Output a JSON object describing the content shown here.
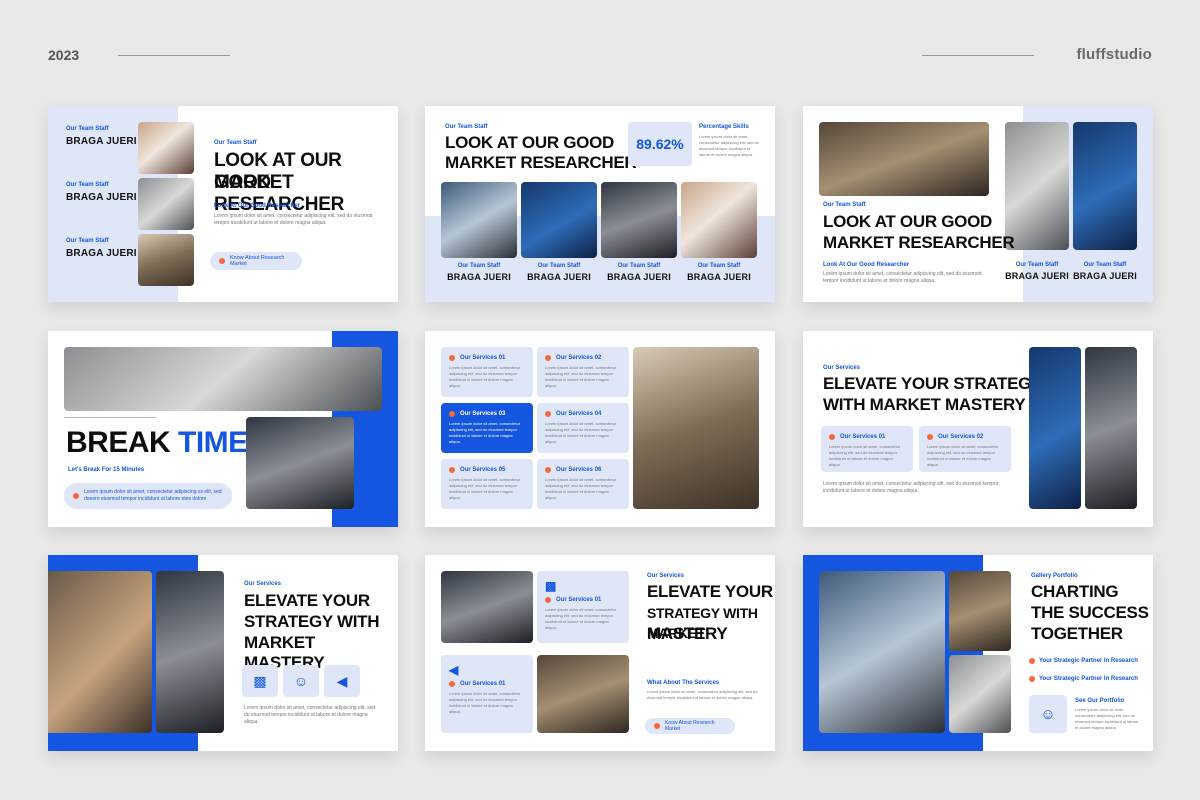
{
  "header": {
    "year": "2023",
    "brand": "fluffstudio"
  },
  "common": {
    "staff_tag": "Our Team Staff",
    "staff_name": "BRAGA JUERI",
    "lorem_short": "Lorem ipsum dolor sit amet, consectetur adipiscing elit, sed do eiusmod tempor incididunt ut labore et dolore magna aliqua.",
    "lorem_card": "Lorem ipsum dolor sit amet, consectetur adipiscing elit, sed do eiusmod tempor incididunt ut labore et dolore magna aliqua."
  },
  "slide1": {
    "tag": "Our Team Staff",
    "title_l1": "LOOK AT OUR GOOD",
    "title_l2": "MARKET RESEARCHER",
    "sub": "Look At Our Good Researcher",
    "pill": "Know About Research Market"
  },
  "slide2": {
    "tag": "Our Team Staff",
    "title_l1": "LOOK AT OUR GOOD",
    "title_l2": "MARKET RESEARCHER",
    "percent": "89.62%",
    "percent_label": "Percentage Skills"
  },
  "slide3": {
    "tag": "Our Team Staff",
    "title_l1": "LOOK AT OUR GOOD",
    "title_l2": "MARKET RESEARCHER",
    "sub": "Look At Our Good Researcher"
  },
  "slide4": {
    "title_a": "BREAK",
    "title_b": "TIME",
    "sub": "Let's Break For 15 Minutes",
    "pill": "Lorem ipsum dolor sit amet, consectetur adipiscing ss elit, sed doeero eiusmod tempor incididunt ut labore etes dolore"
  },
  "slide5": {
    "services": [
      "Our Services 01",
      "Our Services 02",
      "Our Services 03",
      "Our Services 04",
      "Our Services 05",
      "Our Services 06"
    ]
  },
  "slide6": {
    "tag": "Our Services",
    "title_l1": "ELEVATE YOUR STRATEGY",
    "title_l2": "WITH MARKET MASTERY",
    "cards": [
      "Our Services 01",
      "Our Services 02"
    ]
  },
  "slide7": {
    "tag": "Our Services",
    "title_l1": "ELEVATE YOUR",
    "title_l2": "STRATEGY WITH",
    "title_l3": "MARKET MASTERY"
  },
  "slide8": {
    "tag": "Our Services",
    "title_l1": "ELEVATE YOUR",
    "title_l2": "STRATEGY WITH MARKET",
    "title_l3": "MASTERY",
    "card1": "Our Services 01",
    "card2": "Our Services 01",
    "sub": "What About The Services",
    "pill": "Know About Research Market"
  },
  "slide9": {
    "tag": "Gallery Portfolio",
    "title_l1": "CHARTING",
    "title_l2": "THE SUCCESS",
    "title_l3": "TOGETHER",
    "bullet1": "Your Strategic Partner In Research",
    "bullet2": "Your Strategic Partner In Research",
    "see": "See Our Portfolio"
  },
  "colors": {
    "accent": "#1456e0",
    "soft": "#dfe6f7",
    "dot": "#f26a3d",
    "bg": "#e8e8e8"
  }
}
